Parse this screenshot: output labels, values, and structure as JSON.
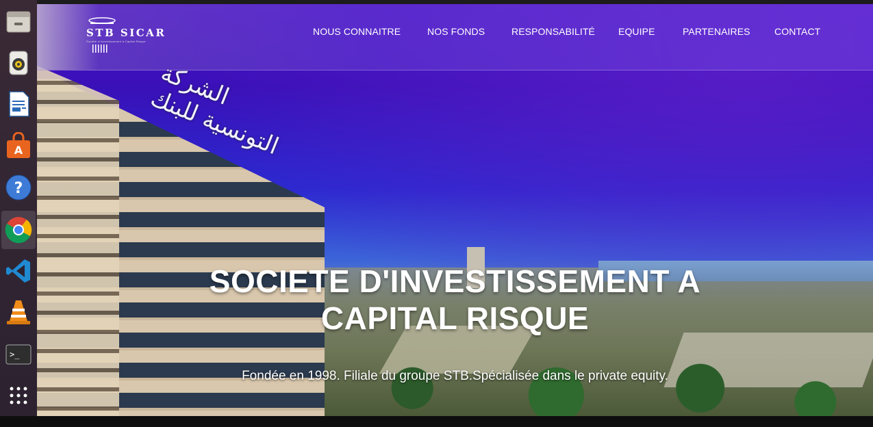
{
  "dock": {
    "items": [
      {
        "name": "files",
        "icon": "file-cabinet-icon"
      },
      {
        "name": "rhythmbox",
        "icon": "speaker-icon"
      },
      {
        "name": "writer",
        "icon": "document-icon"
      },
      {
        "name": "software",
        "icon": "shopping-bag-icon"
      },
      {
        "name": "help",
        "icon": "question-icon"
      },
      {
        "name": "chrome",
        "icon": "chrome-icon"
      },
      {
        "name": "vscode",
        "icon": "vscode-icon"
      },
      {
        "name": "vlc",
        "icon": "cone-icon"
      },
      {
        "name": "terminal",
        "icon": "terminal-icon"
      },
      {
        "name": "apps",
        "icon": "grid-icon"
      }
    ]
  },
  "site": {
    "logo": {
      "text": "STB SICAR",
      "tagline": "Société d'Investissement à Capital Risque"
    },
    "nav": [
      {
        "label": "NOUS CONNAITRE"
      },
      {
        "label": "NOS FONDS"
      },
      {
        "label": "RESPONSABILITÉ"
      },
      {
        "label": "EQUIPE"
      },
      {
        "label": "PARTENAIRES"
      },
      {
        "label": "CONTACT"
      }
    ],
    "hero": {
      "title_line1": "SOCIETE D'INVESTISSEMENT A",
      "title_line2": "CAPITAL RISQUE",
      "subtitle": "Fondée en 1998. Filiale du groupe STB.Spécialisée dans le private equity.",
      "building_sign": "الشركة التونسية للبنك"
    }
  },
  "colors": {
    "dock_bg": "#2c2230",
    "header_overlay": "#6a3cd2",
    "text": "#ffffff"
  }
}
